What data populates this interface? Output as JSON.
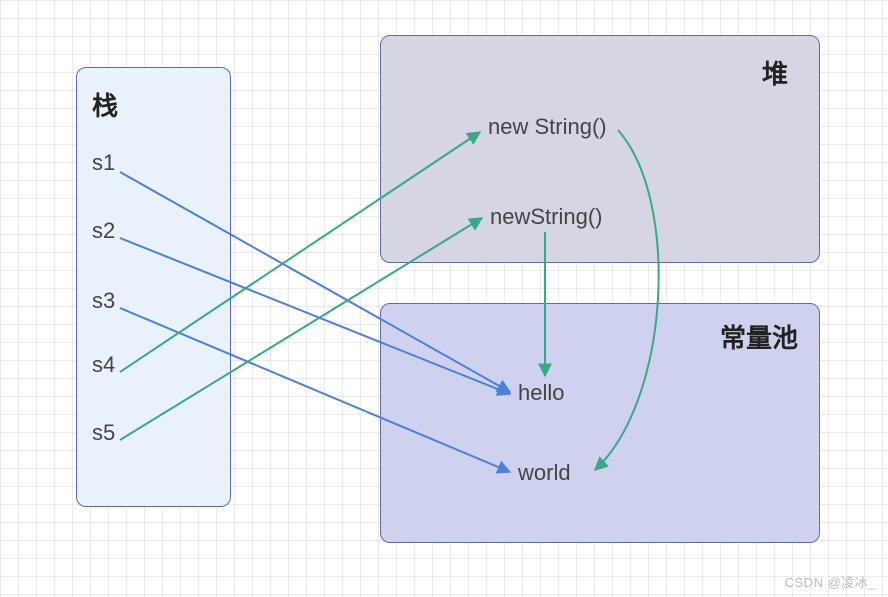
{
  "stack": {
    "title": "栈",
    "items": [
      "s1",
      "s2",
      "s3",
      "s4",
      "s5"
    ]
  },
  "heap": {
    "title": "堆",
    "items": [
      "new String()",
      "newString()"
    ]
  },
  "pool": {
    "title": "常量池",
    "items": [
      "hello",
      "world"
    ]
  },
  "arrows": [
    {
      "from": "s1",
      "to": "hello",
      "color": "blue"
    },
    {
      "from": "s2",
      "to": "hello",
      "color": "blue"
    },
    {
      "from": "s3",
      "to": "world",
      "color": "blue"
    },
    {
      "from": "s4",
      "to": "new String()",
      "color": "green"
    },
    {
      "from": "s5",
      "to": "newString()",
      "color": "green"
    },
    {
      "from": "newString()",
      "to": "hello",
      "color": "green"
    },
    {
      "from": "new String()",
      "to": "world",
      "color": "green",
      "curve": true
    }
  ],
  "colors": {
    "blue": "#4e7fd9",
    "green": "#3aa787"
  },
  "watermark": "CSDN @凌冰_"
}
